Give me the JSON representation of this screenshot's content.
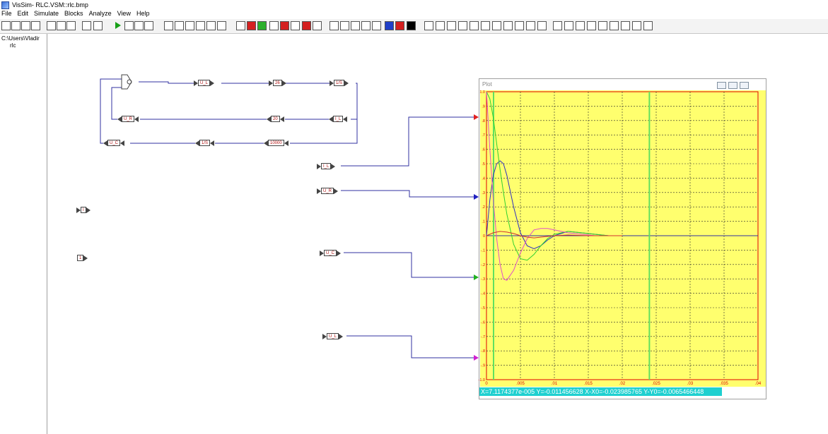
{
  "window": {
    "title": "VisSim- RLC.VSM::rlc.bmp"
  },
  "menu": [
    "File",
    "Edit",
    "Simulate",
    "Blocks",
    "Analyze",
    "View",
    "Help"
  ],
  "tree": {
    "root": "C:\\Users\\Vladir",
    "child": "rlc"
  },
  "blocks": {
    "circuit": [
      "U_L",
      "26",
      "1/S",
      "U_R",
      "20",
      "I_L",
      "U_C",
      "1/S",
      "10000"
    ],
    "outputs": [
      "I_L",
      "U_R",
      "U_C",
      "U_L"
    ],
    "misc1": "I",
    "misc2": "1"
  },
  "plot": {
    "title": "Plot",
    "readout": "X=7.1174377e-005  Y=-0.011456628 X-X0=-0.023985765 Y-Y0=-0.0065466448",
    "colors": {
      "background": "#ffff6e",
      "grid": "#2a2a2a",
      "border": "#e00000",
      "tick": "#e00000",
      "cursor": "#60e060"
    },
    "chart_data": {
      "type": "line",
      "xlim": [
        0,
        0.04
      ],
      "ylim": [
        -1.0,
        1.0
      ],
      "xticks": [
        "0",
        ".005",
        ".01",
        ".015",
        ".02",
        ".025",
        ".03",
        ".035",
        ".04"
      ],
      "yticks": [
        "1.0",
        ".9",
        ".8",
        ".7",
        ".6",
        ".5",
        ".4",
        ".3",
        ".2",
        ".1",
        "0",
        "-.1",
        "-.2",
        "-.3",
        "-.4",
        "-.5",
        "-.6",
        "-.7",
        "-.8",
        "-.9",
        "-1.0"
      ],
      "grid": true,
      "cursor_x": 0.024,
      "series": [
        {
          "color": "#3030c0",
          "x": [
            0,
            0.0005,
            0.001,
            0.0015,
            0.002,
            0.0025,
            0.003,
            0.004,
            0.005,
            0.006,
            0.007,
            0.008,
            0.009,
            0.01,
            0.012,
            0.014,
            0.016,
            0.018,
            0.02
          ],
          "y": [
            0,
            0.25,
            0.42,
            0.5,
            0.52,
            0.5,
            0.42,
            0.2,
            0.02,
            -0.07,
            -0.09,
            -0.07,
            -0.03,
            0.0,
            0.03,
            0.02,
            0.01,
            0.0,
            0.0
          ]
        },
        {
          "color": "#30d030",
          "x": [
            0,
            0.0005,
            0.001,
            0.0015,
            0.002,
            0.0025,
            0.003,
            0.004,
            0.005,
            0.006,
            0.007,
            0.008,
            0.009,
            0.01,
            0.012,
            0.014,
            0.016,
            0.018,
            0.02
          ],
          "y": [
            1.0,
            0.95,
            0.82,
            0.64,
            0.46,
            0.3,
            0.15,
            -0.06,
            -0.16,
            -0.17,
            -0.13,
            -0.07,
            -0.02,
            0.01,
            0.03,
            0.02,
            0.01,
            0.0,
            0.0
          ]
        },
        {
          "color": "#e050c8",
          "x": [
            0,
            0.0005,
            0.001,
            0.0015,
            0.002,
            0.0025,
            0.003,
            0.004,
            0.005,
            0.006,
            0.007,
            0.008,
            0.009,
            0.01,
            0.011,
            0.012,
            0.014,
            0.016,
            0.018,
            0.02
          ],
          "y": [
            1.0,
            0.6,
            0.25,
            -0.02,
            -0.2,
            -0.3,
            -0.31,
            -0.24,
            -0.12,
            -0.02,
            0.04,
            0.05,
            0.05,
            0.04,
            0.03,
            0.02,
            0.01,
            0.0,
            0.0,
            0.0
          ]
        },
        {
          "color": "#d03030",
          "x": [
            0,
            0.001,
            0.002,
            0.003,
            0.004,
            0.005,
            0.006,
            0.007,
            0.008,
            0.01,
            0.012,
            0.015,
            0.02
          ],
          "y": [
            0,
            0.02,
            0.03,
            0.025,
            0.015,
            0.0,
            -0.01,
            -0.015,
            -0.01,
            0.0,
            0.005,
            0.0,
            0.0
          ]
        }
      ]
    }
  }
}
